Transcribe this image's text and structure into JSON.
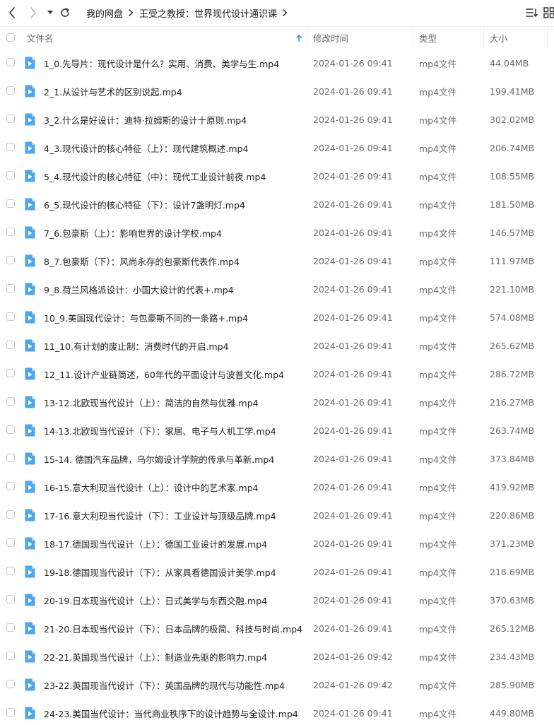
{
  "toolbar": {
    "breadcrumbs": [
      "我的网盘",
      "王受之教授：世界现代设计通识课"
    ]
  },
  "header": {
    "name": "文件名",
    "modified": "修改时间",
    "type": "类型",
    "size": "大小"
  },
  "colors": {
    "accent": "#4a90e2",
    "icon_blue": "#4ea6ea",
    "text_secondary": "#6b6b6b"
  },
  "files": [
    {
      "name": "1_0.先导片：现代设计是什么？实用、消费、美学与生.mp4",
      "modified": "2024-01-26 09:41",
      "type": "mp4文件",
      "size": "44.04MB"
    },
    {
      "name": "2_1.从设计与艺术的区别说起.mp4",
      "modified": "2024-01-26 09:41",
      "type": "mp4文件",
      "size": "199.41MB"
    },
    {
      "name": "3_2.什么是好设计：迪特·拉姆斯的设计十原则.mp4",
      "modified": "2024-01-26 09:41",
      "type": "mp4文件",
      "size": "302.02MB"
    },
    {
      "name": "4_3.现代设计的核心特征（上）：现代建筑概述.mp4",
      "modified": "2024-01-26 09:41",
      "type": "mp4文件",
      "size": "206.74MB"
    },
    {
      "name": "5_4.现代设计的核心特征（中）：现代工业设计前夜.mp4",
      "modified": "2024-01-26 09:41",
      "type": "mp4文件",
      "size": "108.55MB"
    },
    {
      "name": "6_5.现代设计的核心特征（下）：设计7盏明灯.mp4",
      "modified": "2024-01-26 09:41",
      "type": "mp4文件",
      "size": "181.50MB"
    },
    {
      "name": "7_6.包豪斯（上）：影响世界的设计学校.mp4",
      "modified": "2024-01-26 09:41",
      "type": "mp4文件",
      "size": "146.57MB"
    },
    {
      "name": "8_7.包豪斯（下）：风尚永存的包豪斯代表作.mp4",
      "modified": "2024-01-26 09:41",
      "type": "mp4文件",
      "size": "111.97MB"
    },
    {
      "name": "9_8.荷兰风格派设计：小国大设计的代表+.mp4",
      "modified": "2024-01-26 09:41",
      "type": "mp4文件",
      "size": "221.10MB"
    },
    {
      "name": "10_9.美国现代设计：与包豪斯不同的一条路+.mp4",
      "modified": "2024-01-26 09:41",
      "type": "mp4文件",
      "size": "574.08MB"
    },
    {
      "name": "11_10.有计划的废止制：消费时代的开启.mp4",
      "modified": "2024-01-26 09:41",
      "type": "mp4文件",
      "size": "265.62MB"
    },
    {
      "name": "12_11.设计产业链简述，60年代的平面设计与波普文化.mp4",
      "modified": "2024-01-26 09:41",
      "type": "mp4文件",
      "size": "286.72MB"
    },
    {
      "name": "13-12.北欧现当代设计（上）：简洁的自然与优雅.mp4",
      "modified": "2024-01-26 09:41",
      "type": "mp4文件",
      "size": "216.27MB"
    },
    {
      "name": "14-13.北欧现当代设计（下）：家居、电子与人机工学.mp4",
      "modified": "2024-01-26 09:41",
      "type": "mp4文件",
      "size": "263.74MB"
    },
    {
      "name": "15-14. 德国汽车品牌，乌尔姆设计学院的传承与革新.mp4",
      "modified": "2024-01-26 09:41",
      "type": "mp4文件",
      "size": "373.84MB"
    },
    {
      "name": "16-15.意大利现当代设计（上）：设计中的艺术家.mp4",
      "modified": "2024-01-26 09:41",
      "type": "mp4文件",
      "size": "419.92MB"
    },
    {
      "name": "17-16.意大利现当代设计（下）：工业设计与顶级品牌.mp4",
      "modified": "2024-01-26 09:41",
      "type": "mp4文件",
      "size": "220.86MB"
    },
    {
      "name": "18-17.德国现当代设计（上）：德国工业设计的发展.mp4",
      "modified": "2024-01-26 09:41",
      "type": "mp4文件",
      "size": "371.23MB"
    },
    {
      "name": "19-18.德国现当代设计（下）：从家具看德国设计美学.mp4",
      "modified": "2024-01-26 09:41",
      "type": "mp4文件",
      "size": "218.69MB"
    },
    {
      "name": "20-19.日本现当代设计（上）：日式美学与东西交融.mp4",
      "modified": "2024-01-26 09:41",
      "type": "mp4文件",
      "size": "370.63MB"
    },
    {
      "name": "21-20.日本现当代设计（下）：日本品牌的极简、科技与时尚.mp4",
      "modified": "2024-01-26 09:41",
      "type": "mp4文件",
      "size": "265.12MB"
    },
    {
      "name": "22-21.英国现当代设计（上）：制造业先驱的影响力.mp4",
      "modified": "2024-01-26 09:42",
      "type": "mp4文件",
      "size": "234.43MB"
    },
    {
      "name": "23-22.英国现当代设计（下）：英国品牌的现代与功能性.mp4",
      "modified": "2024-01-26 09:42",
      "type": "mp4文件",
      "size": "285.90MB"
    },
    {
      "name": "24-23.美国当代设计：当代商业秩序下的设计趋势与全设计.mp4",
      "modified": "2024-01-26 09:41",
      "type": "mp4文件",
      "size": "449.80MB"
    }
  ]
}
